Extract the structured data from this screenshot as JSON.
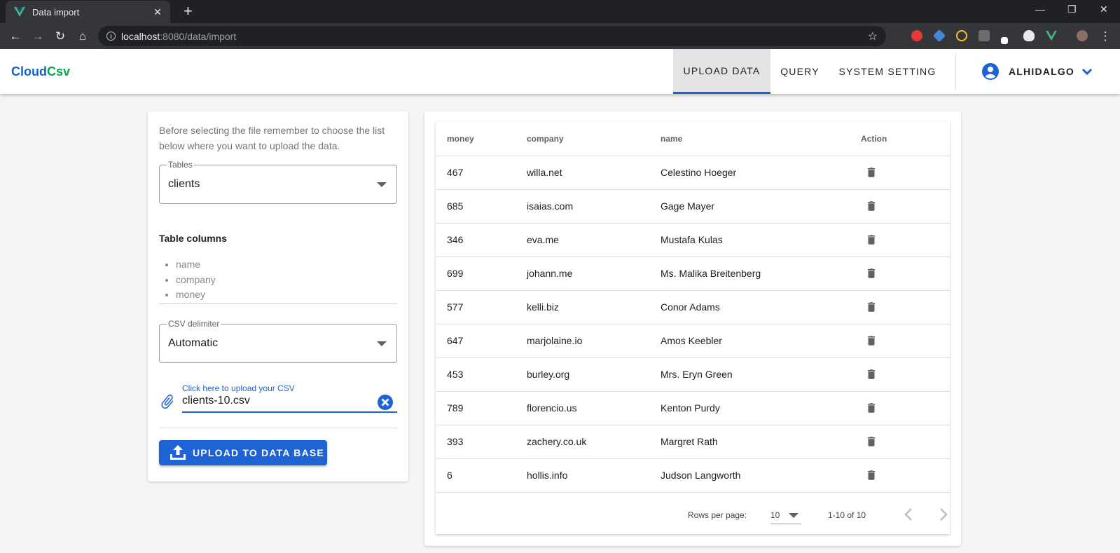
{
  "browser": {
    "tab_title": "Data import",
    "close_glyph": "✕",
    "newtab_glyph": "+",
    "url_host": "localhost",
    "url_rest": ":8080/data/import",
    "window_controls": {
      "minimize": "—",
      "restore": "❐",
      "close": "✕"
    },
    "nav_glyphs": {
      "back": "←",
      "forward": "→",
      "reload": "↻",
      "home": "⌂",
      "star": "☆",
      "menu": "⋮"
    }
  },
  "app": {
    "logo_part1": "Cloud",
    "logo_part2": "Csv",
    "nav": [
      {
        "label": "UPLOAD DATA",
        "active": true
      },
      {
        "label": "QUERY",
        "active": false
      },
      {
        "label": "SYSTEM SETTING",
        "active": false
      }
    ],
    "user_name": "ALHIDALGO"
  },
  "upload_form": {
    "hint": "Before selecting the file remember to choose the list below where you want to upload the data.",
    "tables_label": "Tables",
    "tables_value": "clients",
    "columns_title": "Table columns",
    "columns": [
      "name",
      "company",
      "money"
    ],
    "delimiter_label": "CSV delimiter",
    "delimiter_value": "Automatic",
    "file_label": "Click here to upload your CSV",
    "file_value": "clients-10.csv",
    "upload_button": "UPLOAD TO DATA BASE"
  },
  "table": {
    "headers": {
      "money": "money",
      "company": "company",
      "name": "name",
      "action": "Action"
    },
    "rows": [
      {
        "money": "467",
        "company": "willa.net",
        "name": "Celestino Hoeger"
      },
      {
        "money": "685",
        "company": "isaias.com",
        "name": "Gage Mayer"
      },
      {
        "money": "346",
        "company": "eva.me",
        "name": "Mustafa Kulas"
      },
      {
        "money": "699",
        "company": "johann.me",
        "name": "Ms. Malika Breitenberg"
      },
      {
        "money": "577",
        "company": "kelli.biz",
        "name": "Conor Adams"
      },
      {
        "money": "647",
        "company": "marjolaine.io",
        "name": "Amos Keebler"
      },
      {
        "money": "453",
        "company": "burley.org",
        "name": "Mrs. Eryn Green"
      },
      {
        "money": "789",
        "company": "florencio.us",
        "name": "Kenton Purdy"
      },
      {
        "money": "393",
        "company": "zachery.co.uk",
        "name": "Margret Rath"
      },
      {
        "money": "6",
        "company": "hollis.info",
        "name": "Judson Langworth"
      }
    ],
    "rows_per_page_label": "Rows per page:",
    "rows_per_page_value": "10",
    "range_text": "1-10 of 10"
  },
  "colors": {
    "primary": "#1e63d6",
    "logo_blue": "#1565c0",
    "logo_green": "#0aa34f"
  }
}
